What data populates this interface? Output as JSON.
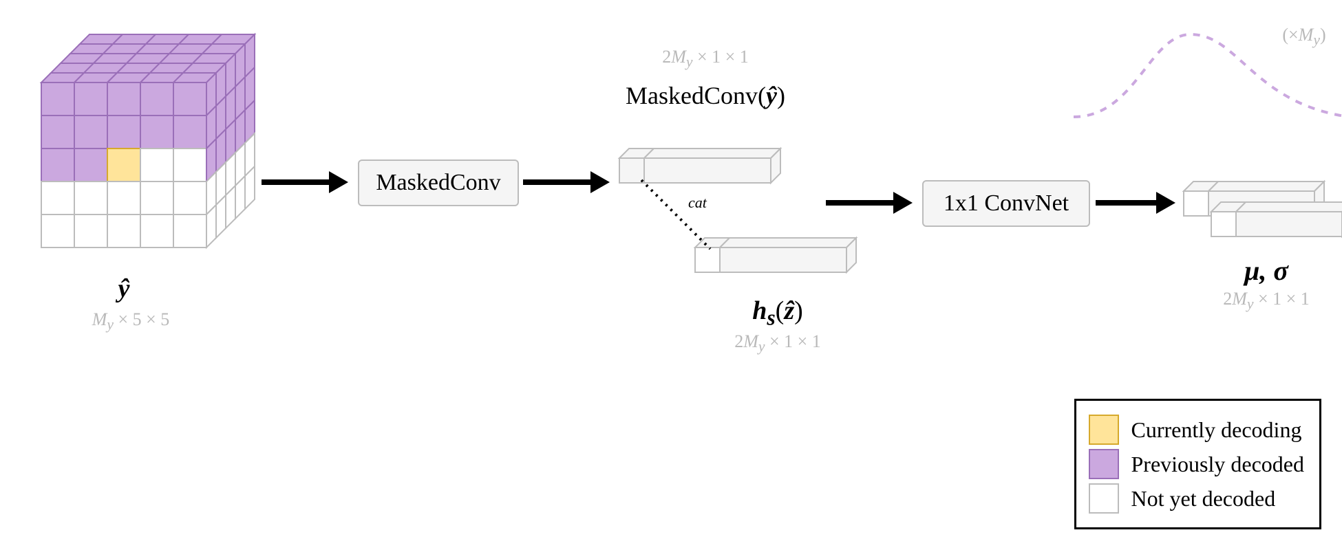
{
  "labels": {
    "y_hat": "ŷ",
    "y_hat_dims": "M_y × 5 × 5",
    "masked_conv_op": "MaskedConv",
    "masked_conv_y": "MaskedConv(ŷ)",
    "masked_conv_dims": "2M_y × 1 × 1",
    "hs_z": "h_s(ẑ)",
    "hs_z_dims": "2M_y × 1 × 1",
    "cat": "cat",
    "convnet_op": "1x1 ConvNet",
    "mu_sigma": "μ, σ",
    "mu_sigma_dims": "2M_y × 1 × 1",
    "times_my": "(×M_y)"
  },
  "legend": {
    "current": "Currently decoding",
    "prev": "Previously decoded",
    "notyet": "Not yet decoded"
  },
  "colors": {
    "purple_fill": "#cba8df",
    "purple_stroke": "#9a6fb8",
    "yellow_fill": "#ffe49a",
    "yellow_stroke": "#d6a92c",
    "white_fill": "#ffffff",
    "gray_stroke": "#bcbcbc",
    "box_fill": "#f5f5f5",
    "curve_stroke": "#cba8df"
  },
  "diagram": {
    "flow": [
      "ŷ",
      "MaskedConv",
      "MaskedConv(ŷ) ⊕cat h_s(ẑ)",
      "1x1 ConvNet",
      "μ, σ"
    ],
    "gaussian_count": "M_y"
  }
}
